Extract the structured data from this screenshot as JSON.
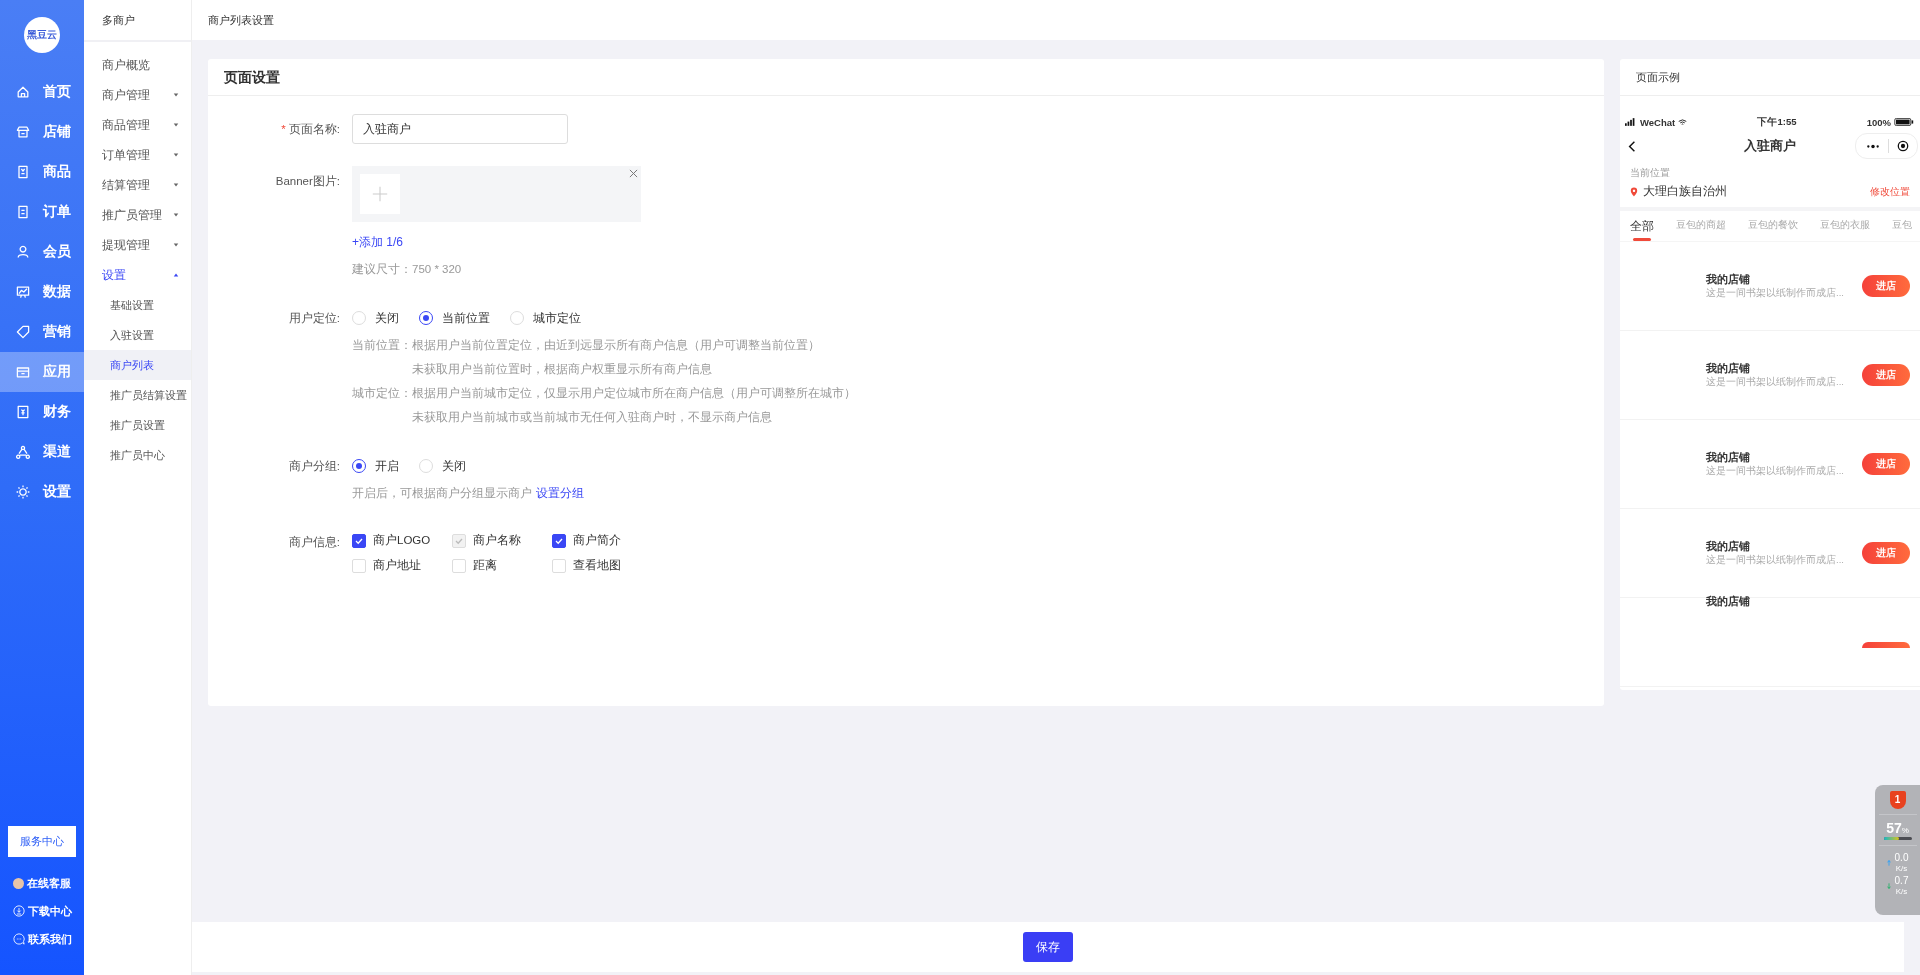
{
  "brand": {
    "logo_text": "黑豆云"
  },
  "main_nav": [
    {
      "label": "首页",
      "selected": false
    },
    {
      "label": "店铺",
      "selected": false
    },
    {
      "label": "商品",
      "selected": false
    },
    {
      "label": "订单",
      "selected": false
    },
    {
      "label": "会员",
      "selected": false
    },
    {
      "label": "数据",
      "selected": false
    },
    {
      "label": "营销",
      "selected": false
    },
    {
      "label": "应用",
      "selected": true
    },
    {
      "label": "财务",
      "selected": false
    },
    {
      "label": "渠道",
      "selected": false
    },
    {
      "label": "设置",
      "selected": false
    }
  ],
  "service_button": "服务中心",
  "footer_links": [
    {
      "kind": "avatar",
      "label": "在线客服"
    },
    {
      "kind": "download",
      "label": "下载中心"
    },
    {
      "kind": "chat",
      "label": "联系我们"
    }
  ],
  "sub_nav": {
    "title": "多商户",
    "items": [
      {
        "label": "商户概览"
      },
      {
        "label": "商户管理",
        "expanded": false
      },
      {
        "label": "商品管理",
        "expanded": false
      },
      {
        "label": "订单管理",
        "expanded": false
      },
      {
        "label": "结算管理",
        "expanded": false
      },
      {
        "label": "推广员管理",
        "expanded": false
      },
      {
        "label": "提现管理",
        "expanded": false
      },
      {
        "label": "设置",
        "expanded": true,
        "children": [
          {
            "label": "基础设置",
            "selected": false
          },
          {
            "label": "入驻设置",
            "selected": false
          },
          {
            "label": "商户列表",
            "selected": true
          },
          {
            "label": "推广员结算设置",
            "selected": false
          },
          {
            "label": "推广员设置",
            "selected": false
          },
          {
            "label": "推广员中心",
            "selected": false
          }
        ]
      }
    ]
  },
  "breadcrumb": "商户列表设置",
  "form": {
    "title": "页面设置",
    "page_name": {
      "label": "页面名称:",
      "required_mark": "*",
      "value": "入驻商户"
    },
    "banner": {
      "label": "Banner图片:",
      "add_link": "+添加 1/6",
      "hint": "建议尺寸：750 * 320"
    },
    "user_location": {
      "label": "用户定位:",
      "options": [
        {
          "label": "关闭",
          "selected": false
        },
        {
          "label": "当前位置",
          "selected": true
        },
        {
          "label": "城市定位",
          "selected": false
        }
      ],
      "notes": [
        {
          "label": "当前位置：",
          "lines": [
            "根据用户当前位置定位，由近到远显示所有商户信息（用户可调整当前位置）",
            "未获取用户当前位置时，根据商户权重显示所有商户信息"
          ]
        },
        {
          "label": "城市定位：",
          "lines": [
            "根据用户当前城市定位，仅显示用户定位城市所在商户信息（用户可调整所在城市）",
            "未获取用户当前城市或当前城市无任何入驻商户时，不显示商户信息"
          ]
        }
      ]
    },
    "grouping": {
      "label": "商户分组:",
      "options": [
        {
          "label": "开启",
          "selected": true
        },
        {
          "label": "关闭",
          "selected": false
        }
      ],
      "hint": "开启后，可根据商户分组显示商户",
      "link": "设置分组"
    },
    "merchant_info": {
      "label": "商户信息:",
      "options": [
        {
          "label": "商户LOGO",
          "checked": true,
          "disabled": false
        },
        {
          "label": "商户名称",
          "checked": true,
          "disabled": true
        },
        {
          "label": "商户简介",
          "checked": true,
          "disabled": false
        },
        {
          "label": "商户地址",
          "checked": false,
          "disabled": false
        },
        {
          "label": "距离",
          "checked": false,
          "disabled": false
        },
        {
          "label": "查看地图",
          "checked": false,
          "disabled": false
        }
      ]
    }
  },
  "preview": {
    "title": "页面示例",
    "status_bar": {
      "carrier": "WeChat",
      "time": "下午1:55",
      "battery": "100%"
    },
    "nav_title": "入驻商户",
    "location": {
      "caption": "当前位置",
      "city": "大理白族自治州",
      "change": "修改位置"
    },
    "tabs": [
      {
        "label": "全部",
        "selected": true
      },
      {
        "label": "豆包的商超",
        "selected": false
      },
      {
        "label": "豆包的餐饮",
        "selected": false
      },
      {
        "label": "豆包的衣服",
        "selected": false
      },
      {
        "label": "豆包",
        "selected": false
      }
    ],
    "stores": [
      {
        "title": "我的店铺",
        "description": "这是一间书架以纸制作而成店...",
        "button": "进店"
      },
      {
        "title": "我的店铺",
        "description": "这是一间书架以纸制作而成店...",
        "button": "进店"
      },
      {
        "title": "我的店铺",
        "description": "这是一间书架以纸制作而成店...",
        "button": "进店"
      },
      {
        "title": "我的店铺",
        "description": "这是一间书架以纸制作而成店...",
        "button": "进店"
      },
      {
        "title": "我的店铺"
      }
    ]
  },
  "save_button": "保存",
  "monitor": {
    "badge": "1",
    "percent": "57",
    "percent_unit": "%",
    "level": 0.57,
    "upload": "0.0",
    "upload_unit": "K/s",
    "download": "0.7",
    "download_unit": "K/s"
  }
}
